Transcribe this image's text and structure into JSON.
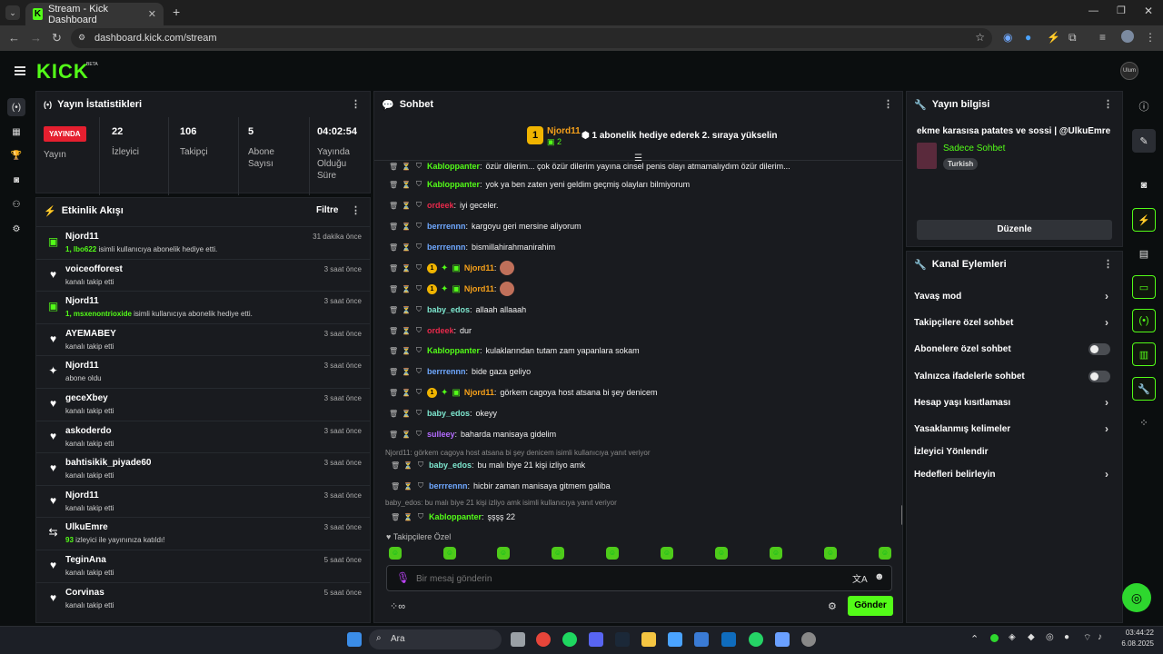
{
  "browser": {
    "tab_title": "Stream - Kick Dashboard",
    "url": "dashboard.kick.com/stream"
  },
  "brand": {
    "logo": "KICK",
    "beta": "BETA",
    "avatar_text": "Ulum",
    "accent": "#53fc18"
  },
  "stats": {
    "title": "Yayın İstatistikleri",
    "live_badge": "YAYINDA",
    "live_label": "Yayın",
    "items": [
      {
        "value": "22",
        "label": "İzleyici"
      },
      {
        "value": "106",
        "label": "Takipçi"
      },
      {
        "value": "5",
        "label": "Abone Sayısı"
      },
      {
        "value": "04:02:54",
        "label": "Yayında Olduğu Süre"
      }
    ]
  },
  "activity": {
    "title": "Etkinlik Akışı",
    "filter": "Filtre",
    "items": [
      {
        "name": "Njord11",
        "desc_prefix": "1, lbo622",
        "desc": " isimli kullanıcıya abonelik hediye etti.",
        "time": "31 dakika önce",
        "icon": "gift-icon"
      },
      {
        "name": "voiceofforest",
        "desc_prefix": "",
        "desc": "kanalı takip etti",
        "time": "3 saat önce",
        "icon": "heart-icon"
      },
      {
        "name": "Njord11",
        "desc_prefix": "1, msxenontrioxide",
        "desc": " isimli kullanıcıya abonelik hediye etti.",
        "time": "3 saat önce",
        "icon": "gift-icon"
      },
      {
        "name": "AYEMABEY",
        "desc_prefix": "",
        "desc": "kanalı takip etti",
        "time": "3 saat önce",
        "icon": "heart-icon"
      },
      {
        "name": "Njord11",
        "desc_prefix": "",
        "desc": "abone oldu",
        "time": "3 saat önce",
        "icon": "sparkle-icon"
      },
      {
        "name": "geceXbey",
        "desc_prefix": "",
        "desc": "kanalı takip etti",
        "time": "3 saat önce",
        "icon": "heart-icon"
      },
      {
        "name": "askoderdo",
        "desc_prefix": "",
        "desc": "kanalı takip etti",
        "time": "3 saat önce",
        "icon": "heart-icon"
      },
      {
        "name": "bahtisikik_piyade60",
        "desc_prefix": "",
        "desc": "kanalı takip etti",
        "time": "3 saat önce",
        "icon": "heart-icon"
      },
      {
        "name": "Njord11",
        "desc_prefix": "",
        "desc": "kanalı takip etti",
        "time": "3 saat önce",
        "icon": "heart-icon"
      },
      {
        "name": "UlkuEmre",
        "desc_prefix": "93",
        "desc": " izleyici ile yayınınıza katıldı!",
        "time": "3 saat önce",
        "icon": "raid-icon"
      },
      {
        "name": "TeginAna",
        "desc_prefix": "",
        "desc": "kanalı takip etti",
        "time": "5 saat önce",
        "icon": "heart-icon"
      },
      {
        "name": "Corvinas",
        "desc_prefix": "",
        "desc": "kanalı takip etti",
        "time": "5 saat önce",
        "icon": "heart-icon"
      }
    ]
  },
  "chat": {
    "title": "Sohbet",
    "pinned_name": "Njord11",
    "pinned_count": "2",
    "pinned_text": "1 abonelik hediye ederek 2. sıraya yükselin",
    "messages": [
      {
        "user": "Kabloppanter",
        "color": "#53fc18",
        "text": "özür dilerim... çok özür dilerim yayına cinsel penis olayı atmamalıydım özür dilerim...",
        "badges": false
      },
      {
        "user": "Kabloppanter",
        "color": "#53fc18",
        "text": "yok ya ben zaten yeni geldim geçmiş olayları bilmiyorum",
        "badges": false
      },
      {
        "user": "ordeek",
        "color": "#e8294b",
        "text": "iyi geceler.",
        "badges": false
      },
      {
        "user": "berrrennn",
        "color": "#6fa8ff",
        "text": "kargoyu geri mersine aliyorum",
        "badges": false
      },
      {
        "user": "berrrennn",
        "color": "#6fa8ff",
        "text": "bismillahirahmanirahim",
        "badges": false
      },
      {
        "user": "Njord11",
        "color": "#f7a11a",
        "text": "",
        "badges": true
      },
      {
        "user": "Njord11",
        "color": "#f7a11a",
        "text": "",
        "badges": true
      },
      {
        "user": "baby_edos",
        "color": "#7ee8d0",
        "text": "allaah allaaah",
        "badges": false
      },
      {
        "user": "ordeek",
        "color": "#e8294b",
        "text": "dur",
        "badges": false
      },
      {
        "user": "Kabloppanter",
        "color": "#53fc18",
        "text": "kulaklarından tutam zam yapanlara sokam",
        "badges": false
      },
      {
        "user": "berrrennn",
        "color": "#6fa8ff",
        "text": "bide gaza geliyo",
        "badges": false
      },
      {
        "user": "Njord11",
        "color": "#f7a11a",
        "text": "görkem cagoya host atsana bi şey denicem",
        "badges": true
      },
      {
        "user": "baby_edos",
        "color": "#7ee8d0",
        "text": "okeyy",
        "badges": false
      },
      {
        "user": "sulleey",
        "color": "#b46bff",
        "text": "baharda manisaya gidelim",
        "badges": false
      },
      {
        "user": "baby_edos",
        "color": "#7ee8d0",
        "text": "bu malı biye 21 kişi izliyo amk",
        "badges": false
      },
      {
        "user": "berrrennn",
        "color": "#6fa8ff",
        "text": "hicbir zaman manisaya gitmem galiba",
        "badges": false
      },
      {
        "user": "Kabloppanter",
        "color": "#53fc18",
        "text": "şşşş 22",
        "badges": false
      }
    ],
    "reply1": "Njord11: görkem cagoya host atsana bi şey denicem isimli kullanıcıya yanıt veriyor",
    "reply2": "baby_edos: bu malı biye 21 kişi izliyo amk isimli kullanıcıya yanıt veriyor",
    "followers_only": "Takipçilere Özel",
    "input_placeholder": "Bir mesaj gönderin",
    "send": "Gönder"
  },
  "stream_info": {
    "title": "Yayın bilgisi",
    "stream_title": "ekme karasısa patates ve sossi | @UlkuEmre",
    "category": "Sadece Sohbet",
    "tag": "Turkish",
    "edit": "Düzenle"
  },
  "channel_actions": {
    "title": "Kanal Eylemleri",
    "items": [
      {
        "label": "Yavaş mod",
        "control": "chevron"
      },
      {
        "label": "Takipçilere özel sohbet",
        "control": "chevron"
      },
      {
        "label": "Abonelere özel sohbet",
        "control": "toggle"
      },
      {
        "label": "Yalnızca ifadelerle sohbet",
        "control": "toggle"
      },
      {
        "label": "Hesap yaşı kısıtlaması",
        "control": "chevron"
      },
      {
        "label": "Yasaklanmış kelimeler",
        "control": "chevron"
      },
      {
        "label": "İzleyici Yönlendir",
        "control": "none"
      },
      {
        "label": "Hedefleri belirleyin",
        "control": "chevron"
      }
    ]
  },
  "taskbar": {
    "search": "Ara",
    "time": "03:44:22",
    "date": "6.08.2025"
  }
}
